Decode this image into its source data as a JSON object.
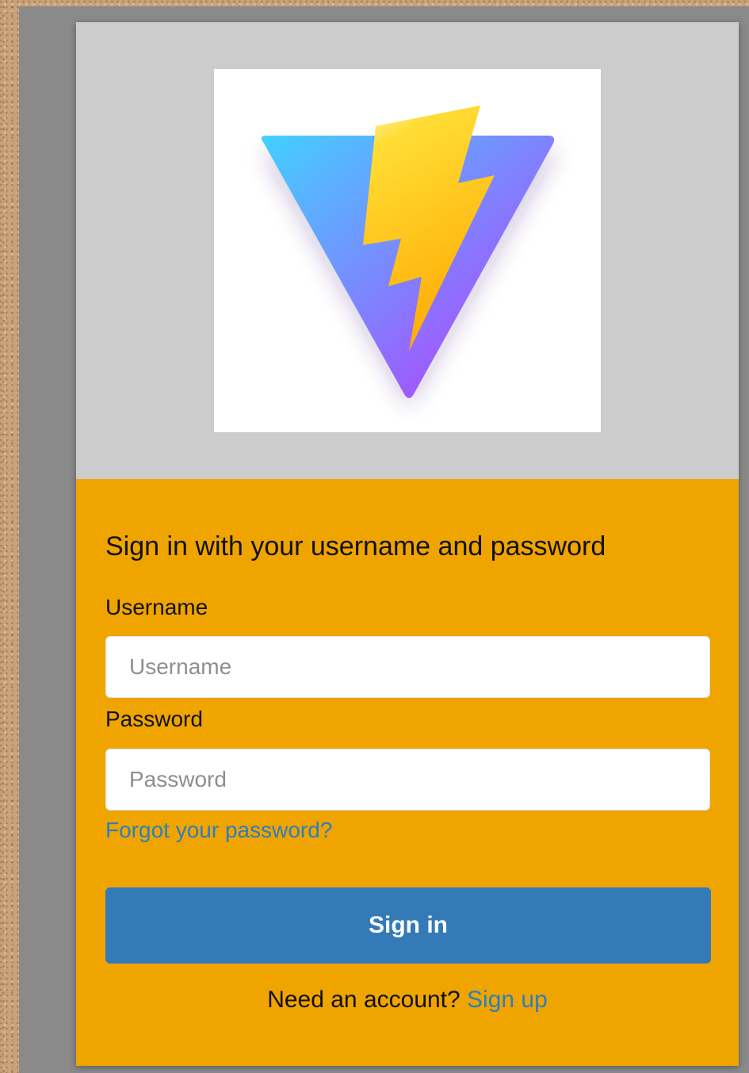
{
  "logo": {
    "icon": "vite-logo-icon",
    "colors": {
      "triangle_start": "#41d1ff",
      "triangle_end": "#bd34fe",
      "bolt_start": "#ffea83",
      "bolt_end": "#ffa800"
    }
  },
  "form": {
    "heading": "Sign in with your username and password",
    "username_label": "Username",
    "username_placeholder": "Username",
    "username_value": "",
    "password_label": "Password",
    "password_placeholder": "Password",
    "password_value": "",
    "forgot_link": "Forgot your password?",
    "submit_label": "Sign in",
    "signup_prompt": "Need an account?",
    "signup_link": "Sign up"
  },
  "colors": {
    "card_background": "#efa400",
    "banner_background": "#cccccc",
    "button_background": "#337ab7",
    "link": "#2c7fbe"
  }
}
